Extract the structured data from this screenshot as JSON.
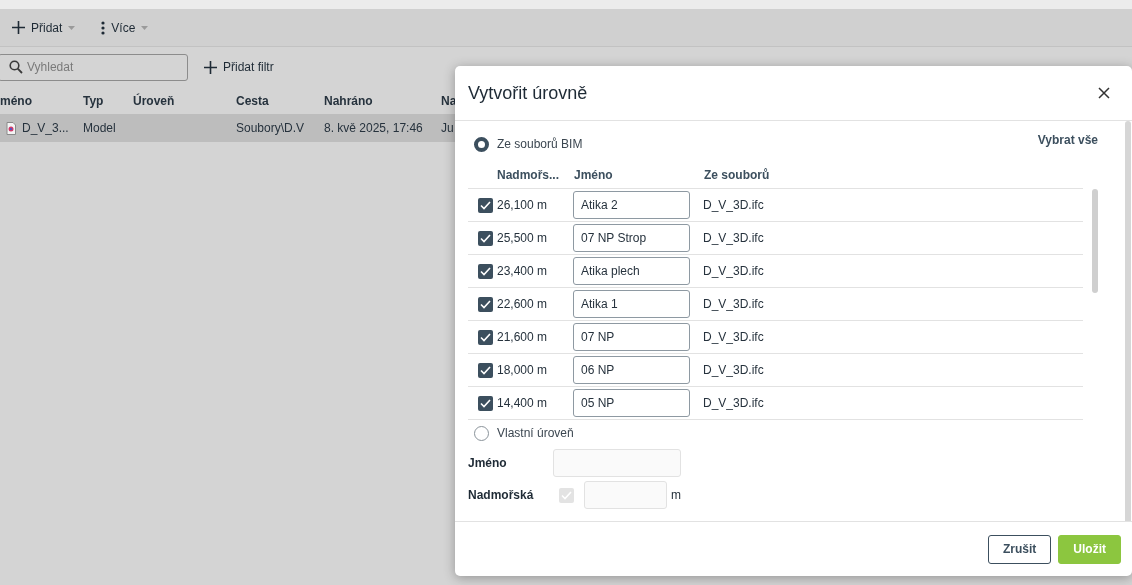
{
  "toolbar": {
    "buttons": [
      {
        "label": "Přidat",
        "kind": "add"
      },
      {
        "label": "Více",
        "kind": "more"
      }
    ]
  },
  "search": {
    "placeholder": "Vyhledat"
  },
  "add_filter": {
    "label": "Přidat filtr"
  },
  "table": {
    "columns": [
      "méno",
      "Typ",
      "Úroveň",
      "Cesta",
      "Nahráno",
      "Na"
    ],
    "rows": [
      {
        "selected": true,
        "cells": [
          "D_V_3...",
          "Model",
          "",
          "Soubory\\D.V",
          "8. kvě 2025, 17:46",
          "Ju"
        ]
      }
    ]
  },
  "dialog": {
    "title": "Vytvořit úrovně",
    "options": [
      {
        "label": "Ze souborů BIM",
        "selected": true
      },
      {
        "label": "Vlastní úroveň",
        "selected": false
      }
    ],
    "select_all": "Vybrat vše",
    "columns": [
      "Nadmořs...",
      "Jméno",
      "Ze souborů"
    ],
    "levels": [
      {
        "checked": true,
        "elevation": "26,100 m",
        "name": "Atika 2",
        "file": "D_V_3D.ifc"
      },
      {
        "checked": true,
        "elevation": "25,500 m",
        "name": "07 NP Strop",
        "file": "D_V_3D.ifc"
      },
      {
        "checked": true,
        "elevation": "23,400 m",
        "name": "Atika plech",
        "file": "D_V_3D.ifc"
      },
      {
        "checked": true,
        "elevation": "22,600 m",
        "name": "Atika 1",
        "file": "D_V_3D.ifc"
      },
      {
        "checked": true,
        "elevation": "21,600 m",
        "name": "07 NP",
        "file": "D_V_3D.ifc"
      },
      {
        "checked": true,
        "elevation": "18,000 m",
        "name": "06 NP",
        "file": "D_V_3D.ifc"
      },
      {
        "checked": true,
        "elevation": "14,400 m",
        "name": "05 NP",
        "file": "D_V_3D.ifc"
      }
    ],
    "custom": {
      "name_label": "Jméno",
      "elevation_label": "Nadmořská",
      "elevation_checked": true,
      "unit": "m"
    },
    "buttons": [
      {
        "label": "Zrušit",
        "kind": "secondary"
      },
      {
        "label": "Uložit",
        "kind": "primary"
      }
    ]
  }
}
